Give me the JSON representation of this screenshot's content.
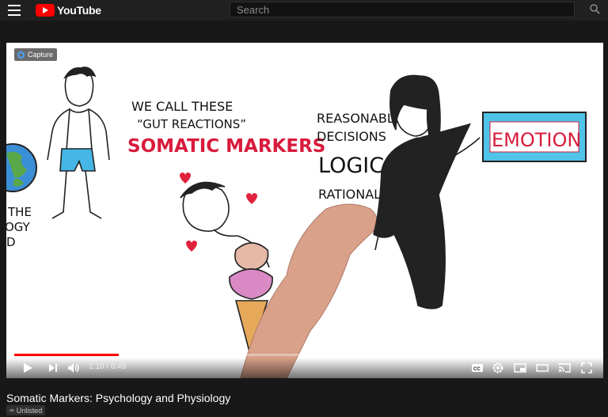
{
  "header": {
    "logo_text": "YouTube",
    "search_placeholder": "Search"
  },
  "player": {
    "capture_label": "Capture",
    "art_text": {
      "line1": "WE CALL THESE",
      "line2": "“GUT REACTIONS”",
      "somatic": "SOMATIC MARKERS",
      "reasonable": "REASONABLE",
      "decisions": "DECISIONS",
      "logic": "LOGIC",
      "rational": "RATIONAL",
      "emotion": "EMOTION",
      "left1": "THE",
      "left2": "OGY",
      "left3": "D"
    },
    "time_display": "1:10 / 6:49",
    "progress_fraction": 0.18
  },
  "video": {
    "title": "Somatic Markers: Psychology and Physiology",
    "visibility": "Unlisted"
  },
  "colors": {
    "accent": "#ff0000",
    "emotion_box": "#4fc3e8",
    "somatic_text": "#d81b3c"
  }
}
